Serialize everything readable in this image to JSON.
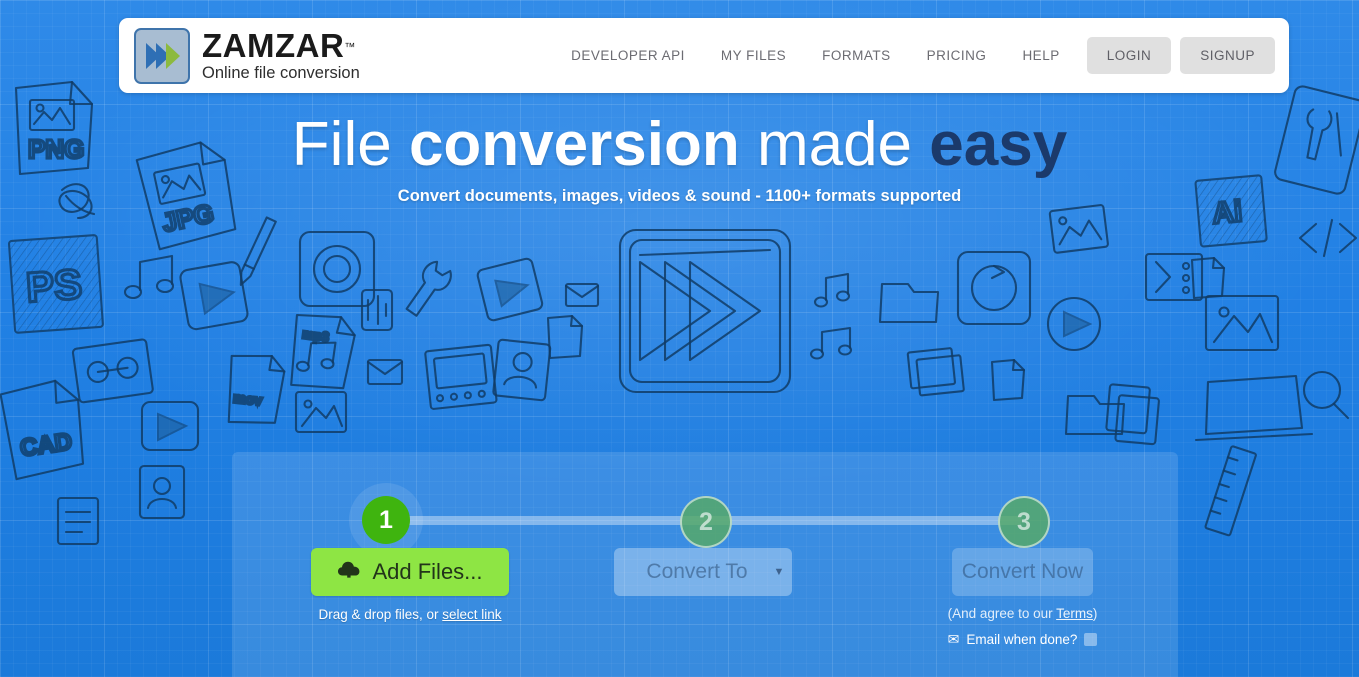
{
  "brand": {
    "name": "ZAMZAR",
    "tm": "™",
    "tagline": "Online file conversion",
    "logo_icon": "zamzar-chevrons-logo",
    "colors": {
      "logo_border": "#3f74ab",
      "logo_fill": "#a8bdd2",
      "logo_chevron_blue": "#2e6fb5",
      "logo_chevron_green": "#8cba3f"
    }
  },
  "nav": {
    "links": [
      {
        "label": "DEVELOPER API"
      },
      {
        "label": "MY FILES"
      },
      {
        "label": "FORMATS"
      },
      {
        "label": "PRICING"
      },
      {
        "label": "HELP"
      }
    ],
    "buttons": [
      {
        "label": "LOGIN"
      },
      {
        "label": "SIGNUP"
      }
    ]
  },
  "hero": {
    "headline_parts": [
      {
        "text": "File ",
        "style": "light"
      },
      {
        "text": "conversion ",
        "style": "bold"
      },
      {
        "text": "made ",
        "style": "light"
      },
      {
        "text": "easy",
        "style": "dark"
      }
    ],
    "subheadline": "Convert documents, images, videos & sound - 1100+ formats supported",
    "center_doodle_icon": "fast-forward-media-sketch"
  },
  "converter": {
    "steps": [
      {
        "number": "1",
        "state": "active"
      },
      {
        "number": "2",
        "state": "idle"
      },
      {
        "number": "3",
        "state": "idle"
      }
    ],
    "step1": {
      "button_label": "Add Files...",
      "button_icon": "cloud-upload-icon",
      "hint_prefix": "Drag & drop files, or ",
      "hint_link": "select link"
    },
    "step2": {
      "select_label": "Convert To",
      "caret_icon": "caret-down-icon"
    },
    "step3": {
      "button_label": "Convert Now",
      "terms_prefix": "(And agree to our ",
      "terms_link": "Terms",
      "terms_suffix": ")",
      "email_icon": "envelope-icon",
      "email_label": "Email when done?",
      "email_checked": false
    },
    "colors": {
      "step_active": "#3fb40f",
      "step_idle": "#56a86a",
      "add_files": "#8ee544"
    }
  },
  "background": {
    "color_top": "#2f8ae8",
    "color_bottom": "#1b7ada",
    "doodle_stroke": "#103c66",
    "doodle_labels": [
      "PNG",
      "JPG",
      "PS",
      "CAD",
      "Ai",
      "mp3",
      "mov"
    ]
  }
}
